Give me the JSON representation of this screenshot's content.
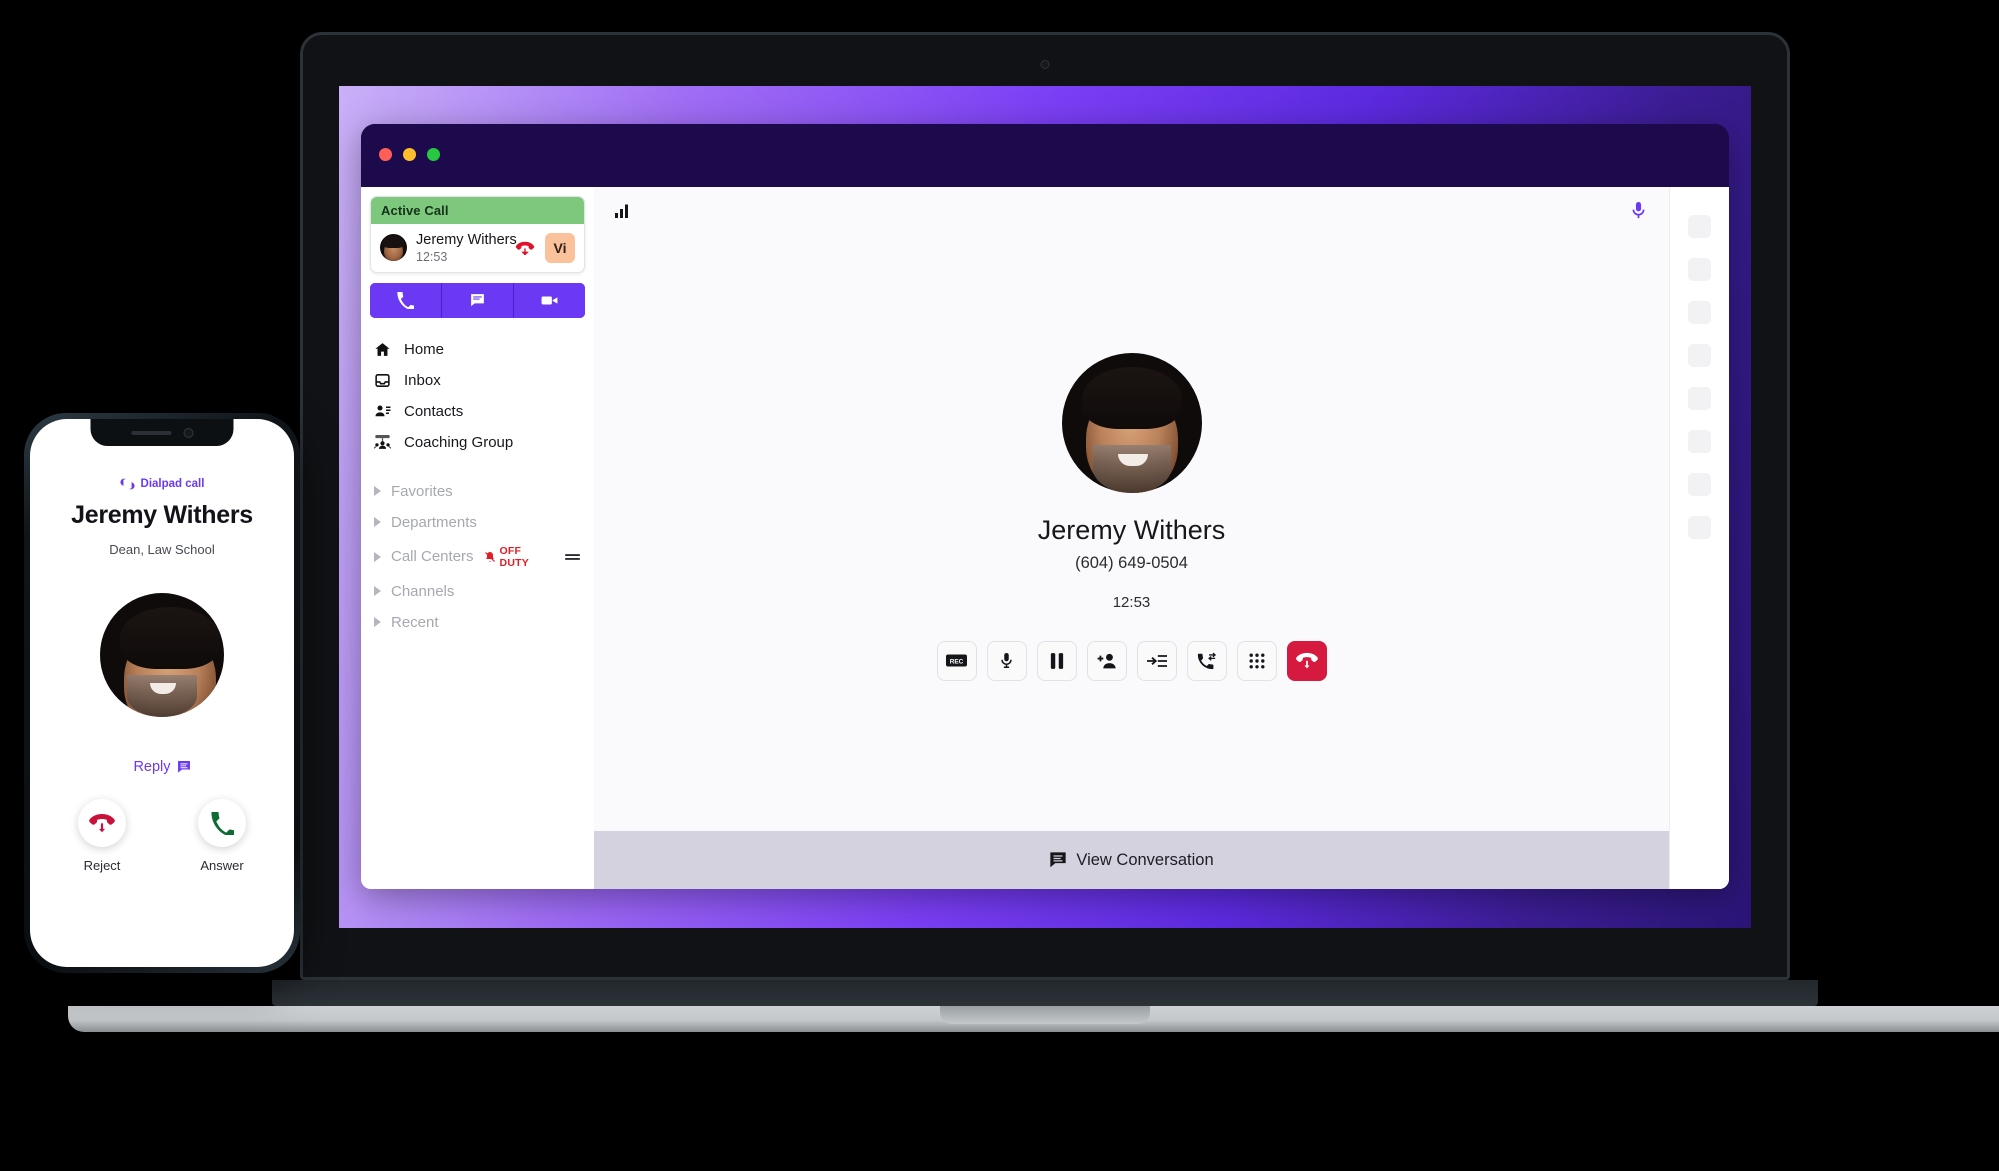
{
  "desktop": {
    "window_controls": [
      "close",
      "minimize",
      "maximize"
    ],
    "sidebar": {
      "active_call": {
        "header": "Active Call",
        "contact_name": "Jeremy Withers",
        "duration": "12:53",
        "hangup_icon": "call-end-icon",
        "badge": "Vi"
      },
      "quick_actions": [
        {
          "name": "call",
          "icon": "phone-icon"
        },
        {
          "name": "message",
          "icon": "message-icon"
        },
        {
          "name": "video",
          "icon": "video-camera-icon"
        }
      ],
      "nav": [
        {
          "label": "Home",
          "icon": "home-icon"
        },
        {
          "label": "Inbox",
          "icon": "inbox-icon"
        },
        {
          "label": "Contacts",
          "icon": "contacts-icon"
        },
        {
          "label": "Coaching Group",
          "icon": "coaching-group-icon"
        }
      ],
      "groups": [
        {
          "label": "Favorites"
        },
        {
          "label": "Departments"
        },
        {
          "label": "Call Centers",
          "status": "OFF DUTY",
          "status_icon": "bell-off-icon",
          "menu_icon": "equalizer-icon"
        },
        {
          "label": "Channels"
        },
        {
          "label": "Recent"
        }
      ]
    },
    "main": {
      "signal_icon": "signal-bars-icon",
      "mic_icon": "microphone-icon",
      "caller_name": "Jeremy Withers",
      "caller_number": "(604) 649-0504",
      "timer": "12:53",
      "controls": [
        {
          "name": "record",
          "icon": "rec-icon"
        },
        {
          "name": "mute",
          "icon": "microphone-icon"
        },
        {
          "name": "hold",
          "icon": "pause-icon"
        },
        {
          "name": "add-participant",
          "icon": "person-add-icon"
        },
        {
          "name": "transfer",
          "icon": "transfer-icon"
        },
        {
          "name": "move-call",
          "icon": "phone-forward-icon"
        },
        {
          "name": "keypad",
          "icon": "dialpad-icon"
        },
        {
          "name": "end-call",
          "icon": "call-end-icon"
        }
      ],
      "footer": {
        "label": "View Conversation",
        "icon": "chat-icon"
      }
    },
    "right_rail": {
      "placeholder_count": 8
    }
  },
  "phone": {
    "brand": "Dialpad call",
    "brand_icon": "dialpad-logo-icon",
    "caller_name": "Jeremy Withers",
    "caller_title": "Dean, Law School",
    "reply": {
      "label": "Reply",
      "icon": "message-icon"
    },
    "actions": [
      {
        "label": "Reject",
        "icon": "call-end-icon"
      },
      {
        "label": "Answer",
        "icon": "phone-icon"
      }
    ]
  },
  "colors": {
    "brand_purple": "#6b39f4",
    "active_green": "#7ec87e",
    "danger_red": "#d5193f",
    "off_duty_red": "#e11d26",
    "badge_peach": "#fbc19a",
    "footer_gray": "#d4d2df",
    "window_navy": "#1c0a4c"
  }
}
